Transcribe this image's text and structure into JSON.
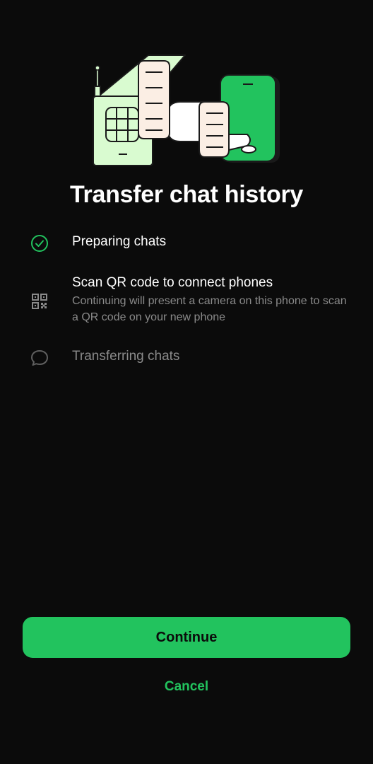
{
  "title": "Transfer chat history",
  "steps": [
    {
      "icon": "check-circle-icon",
      "title": "Preparing chats",
      "description": "",
      "state": "done"
    },
    {
      "icon": "qr-code-icon",
      "title": "Scan QR code to connect phones",
      "description": "Continuing will present a camera on this phone to scan a QR code on your new phone",
      "state": "active"
    },
    {
      "icon": "chat-bubble-icon",
      "title": "Transferring chats",
      "description": "",
      "state": "pending"
    }
  ],
  "buttons": {
    "continue_label": "Continue",
    "cancel_label": "Cancel"
  },
  "colors": {
    "accent": "#22c35e",
    "background": "#0b0b0b",
    "muted_text": "#8a8a8a",
    "illustration_light_green": "#d9fbd0",
    "illustration_paper": "#fbeee4"
  }
}
